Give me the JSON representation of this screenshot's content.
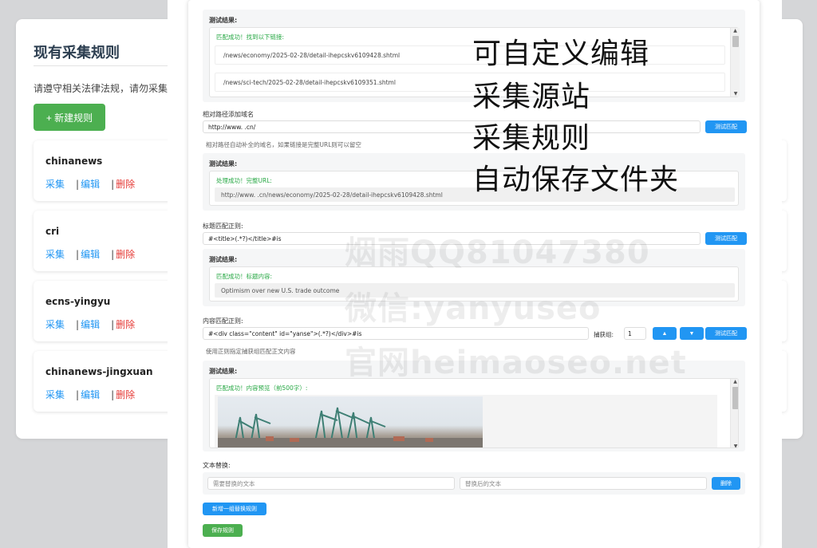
{
  "background": {
    "title": "现有采集规则",
    "notice": "请遵守相关法律法规，请勿采集",
    "new_rule_button": "+ 新建规则",
    "rules": [
      {
        "name": "chinanews",
        "collect": "采集",
        "edit": "编辑",
        "delete": "删除",
        "sep": "|"
      },
      {
        "name": "cri",
        "collect": "采集",
        "edit": "编辑",
        "delete": "删除",
        "sep": "|"
      },
      {
        "name": "ecns-yingyu",
        "collect": "采集",
        "edit": "编辑",
        "delete": "删除",
        "sep": "|"
      },
      {
        "name": "chinanews-jingxuan",
        "collect": "采集",
        "edit": "编辑",
        "delete": "删除",
        "sep": "|"
      }
    ]
  },
  "modal": {
    "link_test": {
      "result_label": "测试结果:",
      "success": "匹配成功！找到以下链接:",
      "links": [
        "/news/economy/2025-02-28/detail-ihepcskv6109428.shtml",
        "/news/sci-tech/2025-02-28/detail-ihepcskv6109351.shtml"
      ]
    },
    "relative_path": {
      "label": "相对路径添加域名",
      "value": "http://www.          .cn/",
      "test_button": "测试匹配",
      "hint": "相对路径自动补全的域名，如果链接是完整URL则可以留空",
      "result_label": "测试结果:",
      "success": "处理成功！完整URL:",
      "full_url": "http://www.          .cn/news/economy/2025-02-28/detail-ihepcskv6109428.shtml"
    },
    "title_regex": {
      "label": "标题匹配正则:",
      "value": "#<title>(.*?)</title>#is",
      "test_button": "测试匹配",
      "result_label": "测试结果:",
      "success": "匹配成功！标题内容:",
      "title_text": "Optimism over new U.S. trade outcome"
    },
    "content_regex": {
      "label": "内容匹配正则:",
      "value": "#<div class=\"content\" id=\"yanse\">(.*?)</div>#is",
      "capture_label": "捕获组:",
      "capture_value": "1",
      "up_arrow": "▲",
      "down_arrow": "▼",
      "test_button": "测试匹配",
      "hint": "使用正则指定捕获组匹配正文内容",
      "result_label": "测试结果:",
      "success": "匹配成功！内容预览（前500字）:"
    },
    "text_replace": {
      "label": "文本替换:",
      "find_placeholder": "需要替换的文本",
      "replace_placeholder": "替换后的文本",
      "delete_button": "删除",
      "add_button": "新增一组替换规则"
    },
    "save_button": "保存规则"
  },
  "overlay": {
    "line1": "可自定义编辑",
    "line2": "采集源站",
    "line3": "采集规则",
    "line4": "自动保存文件夹"
  },
  "watermark": {
    "line1": "烟雨QQ81047380",
    "line2": "微信:yanyuseo",
    "line3": "官网heimaoseo.net"
  },
  "colors": {
    "primary": "#2196f3",
    "success": "#4caf50",
    "danger": "#e53935",
    "match_text": "#27a844"
  }
}
